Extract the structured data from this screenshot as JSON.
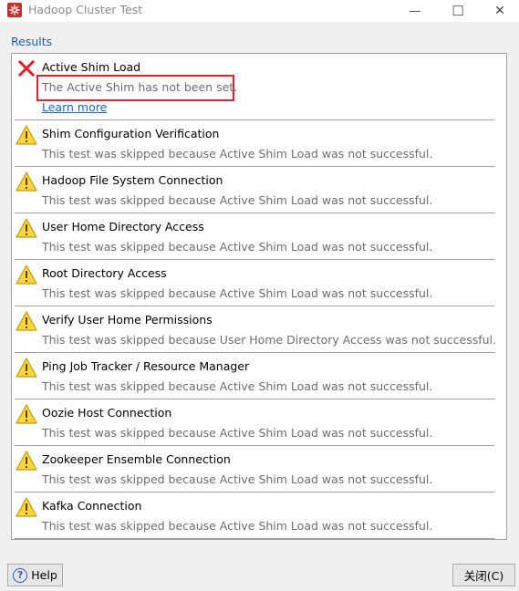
{
  "window": {
    "title": "Hadoop Cluster Test",
    "minimize_glyph": "—",
    "maximize_glyph": "☐",
    "close_glyph": "✕"
  },
  "results_label": "Results",
  "results": [
    {
      "status": "error",
      "icon": "error-x-icon",
      "title": "Active Shim Load",
      "message": "The Active Shim has not been set.",
      "link": "Learn more"
    },
    {
      "status": "warning",
      "icon": "warning-triangle-icon",
      "title": "Shim Configuration Verification",
      "message": "This test was skipped because Active Shim Load was not successful."
    },
    {
      "status": "warning",
      "icon": "warning-triangle-icon",
      "title": "Hadoop File System Connection",
      "message": "This test was skipped because Active Shim Load was not successful."
    },
    {
      "status": "warning",
      "icon": "warning-triangle-icon",
      "title": "User Home Directory Access",
      "message": "This test was skipped because Active Shim Load was not successful."
    },
    {
      "status": "warning",
      "icon": "warning-triangle-icon",
      "title": "Root Directory Access",
      "message": "This test was skipped because Active Shim Load was not successful."
    },
    {
      "status": "warning",
      "icon": "warning-triangle-icon",
      "title": "Verify User Home Permissions",
      "message": "This test was skipped because User Home Directory Access was not successful."
    },
    {
      "status": "warning",
      "icon": "warning-triangle-icon",
      "title": "Ping Job Tracker / Resource Manager",
      "message": "This test was skipped because Active Shim Load was not successful."
    },
    {
      "status": "warning",
      "icon": "warning-triangle-icon",
      "title": "Oozie Host Connection",
      "message": "This test was skipped because Active Shim Load was not successful."
    },
    {
      "status": "warning",
      "icon": "warning-triangle-icon",
      "title": "Zookeeper Ensemble Connection",
      "message": "This test was skipped because Active Shim Load was not successful."
    },
    {
      "status": "warning",
      "icon": "warning-triangle-icon",
      "title": "Kafka Connection",
      "message": "This test was skipped because Active Shim Load was not successful."
    }
  ],
  "buttons": {
    "help_glyph": "?",
    "help_label": "Help",
    "close_label": "关闭(C)"
  },
  "colors": {
    "error": "#e5202d",
    "warning_fill": "#fcd53f",
    "warning_stroke": "#c69b00",
    "link": "#1a63d0",
    "results_label": "#1f5aa6"
  }
}
